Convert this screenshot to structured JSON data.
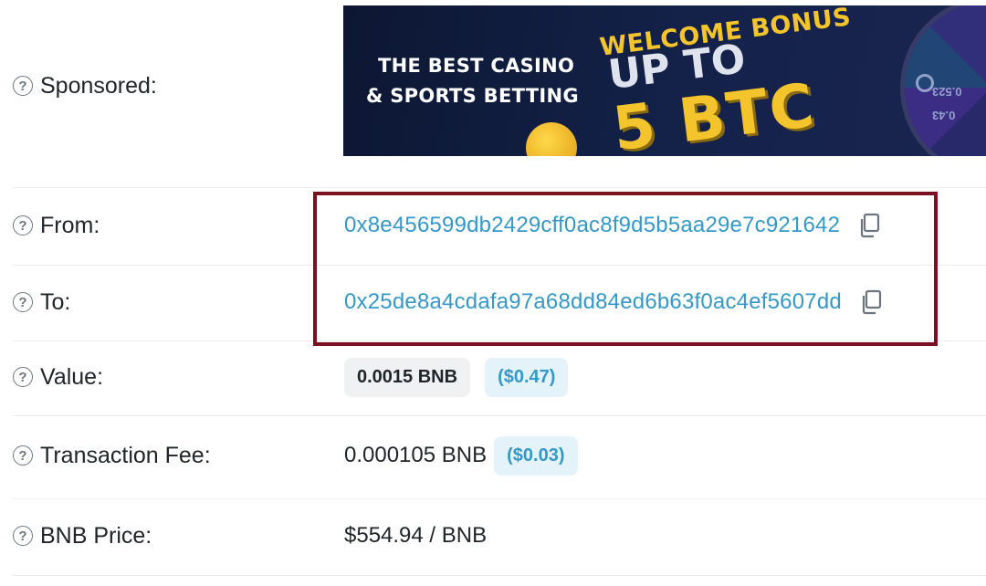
{
  "rows": {
    "sponsored": {
      "label": "Sponsored:"
    },
    "from": {
      "label": "From:",
      "address": "0x8e456599db2429cff0ac8f9d5b5aa29e7c921642"
    },
    "to": {
      "label": "To:",
      "address": "0x25de8a4cdafa97a68dd84ed6b63f0ac4ef5607dd"
    },
    "value": {
      "label": "Value:",
      "amount": "0.0015 BNB",
      "usd": "($0.47)"
    },
    "fee": {
      "label": "Transaction Fee:",
      "amount": "0.000105 BNB",
      "usd": "($0.03)"
    },
    "price": {
      "label": "BNB Price:",
      "amount": "$554.94 / BNB"
    }
  },
  "banner": {
    "line1": "THE BEST CASINO",
    "line2": "& SPORTS BETTING",
    "welcome": "WELCOME BONUS",
    "upto": "UP TO",
    "amount": "5 BTC",
    "wheel_labels": [
      "0.523",
      "0.43"
    ]
  },
  "icons": {
    "help": "question-circle-icon",
    "copy": "copy-icon"
  },
  "colors": {
    "link": "#3498c8",
    "highlight": "#7a1020",
    "banner_gold": "#f3c42b"
  }
}
